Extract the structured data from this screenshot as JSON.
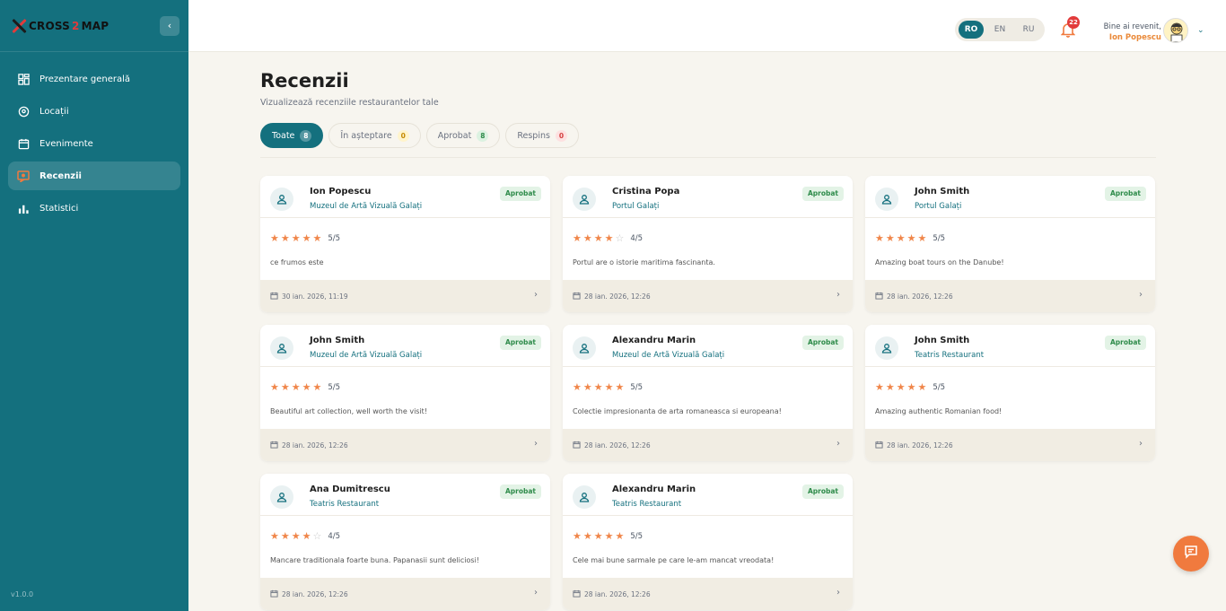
{
  "app": {
    "logo_text_1": "CROSS",
    "logo_text_2": "2",
    "logo_text_3": "MAP",
    "version": "v1.0.0"
  },
  "sidebar": {
    "items": [
      {
        "label": "Prezentare generală",
        "icon": "dashboard-icon",
        "active": false
      },
      {
        "label": "Locații",
        "icon": "location-pin-icon",
        "active": false
      },
      {
        "label": "Evenimente",
        "icon": "calendar-icon",
        "active": false
      },
      {
        "label": "Recenzii",
        "icon": "review-icon",
        "active": true
      },
      {
        "label": "Statistici",
        "icon": "bar-chart-icon",
        "active": false
      }
    ]
  },
  "topbar": {
    "languages": [
      "RO",
      "EN",
      "RU"
    ],
    "active_language": "RO",
    "notification_count": "22",
    "welcome_text": "Bine ai revenit,",
    "user_name": "Ion Popescu"
  },
  "page": {
    "title": "Recenzii",
    "subtitle": "Vizualizează recenziile restaurantelor tale",
    "tabs": [
      {
        "label": "Toate",
        "count": "8"
      },
      {
        "label": "În așteptare",
        "count": "0"
      },
      {
        "label": "Aprobat",
        "count": "8"
      },
      {
        "label": "Respins",
        "count": "0"
      }
    ]
  },
  "reviews": [
    {
      "name": "Ion Popescu",
      "location": "Muzeul de Artă Vizuală Galați",
      "status": "Aprobat",
      "rating": 5,
      "score": "5/5",
      "comment": "ce frumos este",
      "date": "30 ian. 2026, 11:19"
    },
    {
      "name": "Cristina Popa",
      "location": "Portul Galați",
      "status": "Aprobat",
      "rating": 4,
      "score": "4/5",
      "comment": "Portul are o istorie maritima fascinanta.",
      "date": "28 ian. 2026, 12:26"
    },
    {
      "name": "John Smith",
      "location": "Portul Galați",
      "status": "Aprobat",
      "rating": 5,
      "score": "5/5",
      "comment": "Amazing boat tours on the Danube!",
      "date": "28 ian. 2026, 12:26"
    },
    {
      "name": "John Smith",
      "location": "Muzeul de Artă Vizuală Galați",
      "status": "Aprobat",
      "rating": 5,
      "score": "5/5",
      "comment": "Beautiful art collection, well worth the visit!",
      "date": "28 ian. 2026, 12:26"
    },
    {
      "name": "Alexandru Marin",
      "location": "Muzeul de Artă Vizuală Galați",
      "status": "Aprobat",
      "rating": 5,
      "score": "5/5",
      "comment": "Colectie impresionanta de arta romaneasca si europeana!",
      "date": "28 ian. 2026, 12:26"
    },
    {
      "name": "John Smith",
      "location": "Teatris Restaurant",
      "status": "Aprobat",
      "rating": 5,
      "score": "5/5",
      "comment": "Amazing authentic Romanian food!",
      "date": "28 ian. 2026, 12:26"
    },
    {
      "name": "Ana Dumitrescu",
      "location": "Teatris Restaurant",
      "status": "Aprobat",
      "rating": 4,
      "score": "4/5",
      "comment": "Mancare traditionala foarte buna. Papanasii sunt deliciosi!",
      "date": "28 ian. 2026, 12:26"
    },
    {
      "name": "Alexandru Marin",
      "location": "Teatris Restaurant",
      "status": "Aprobat",
      "rating": 5,
      "score": "5/5",
      "comment": "Cele mai bune sarmale pe care le-am mancat vreodata!",
      "date": "28 ian. 2026, 12:26"
    }
  ],
  "colors": {
    "primary": "#14707e",
    "accent": "#f07a3e",
    "star": "#f0864a",
    "approved_bg": "#e3f3e6",
    "approved_text": "#2e8b4a"
  },
  "fab": {
    "icon": "chat-icon"
  }
}
